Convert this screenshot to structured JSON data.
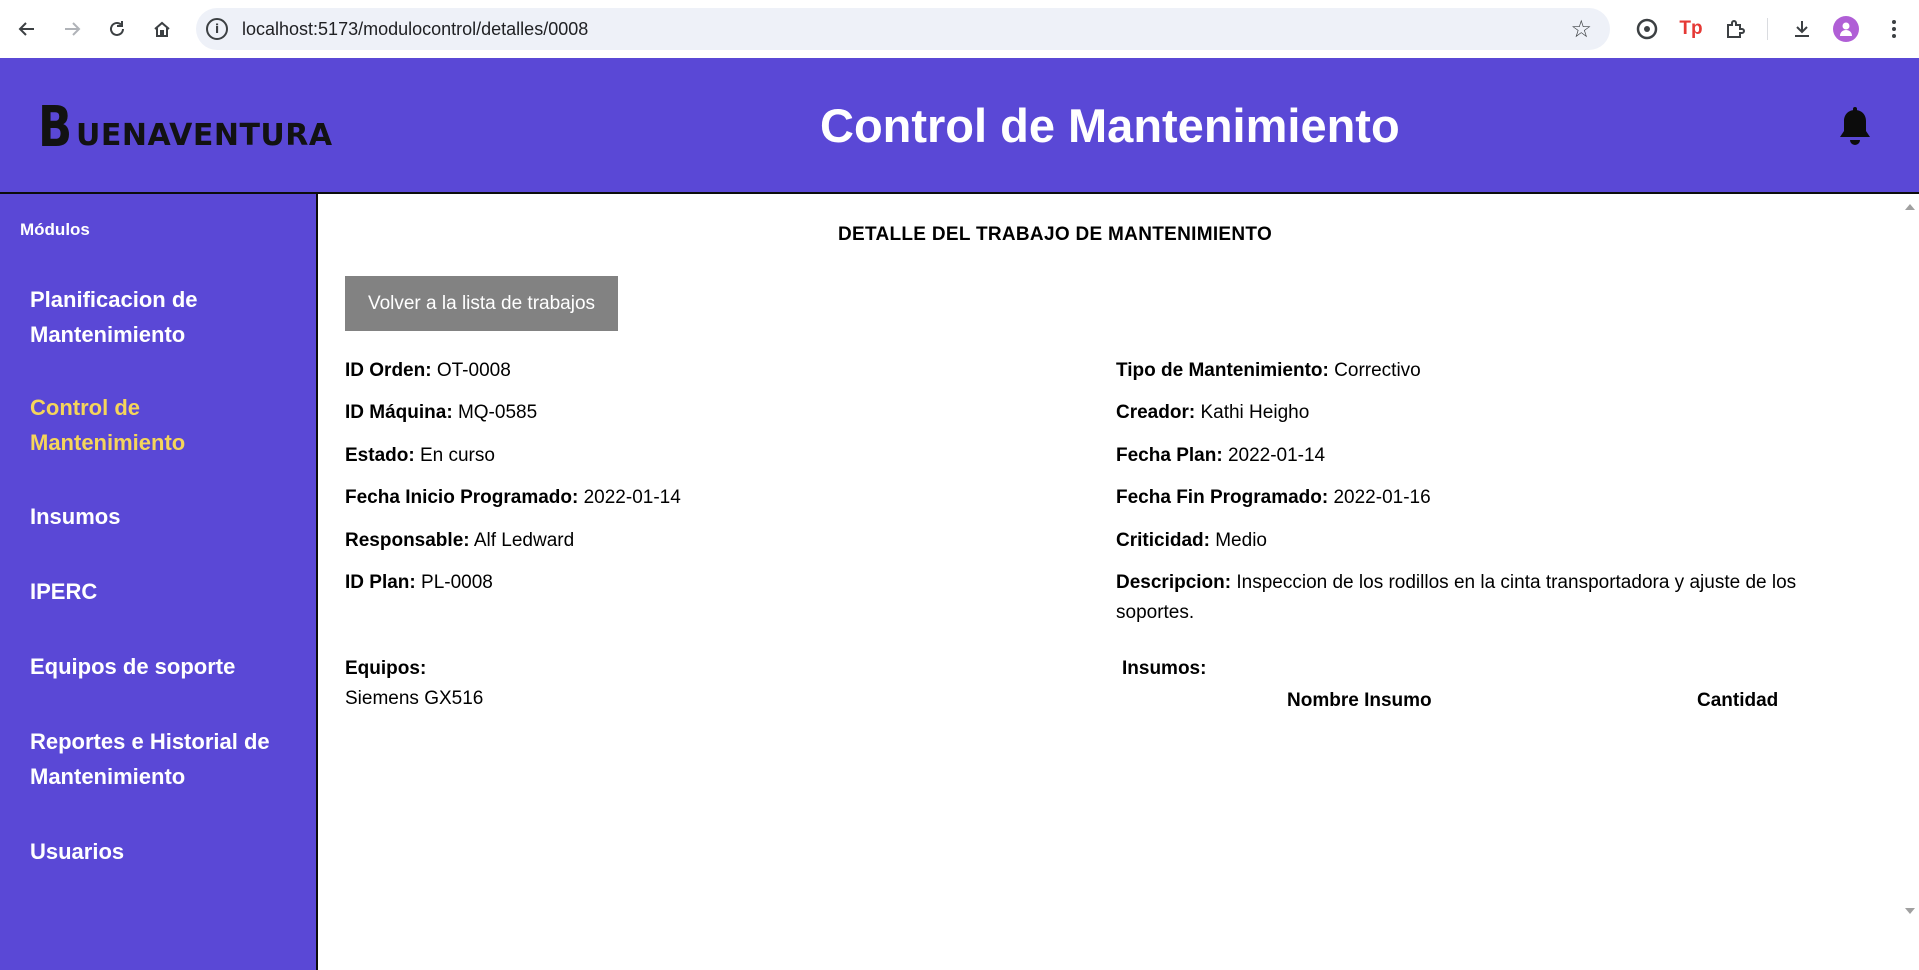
{
  "browser": {
    "url": "localhost:5173/modulocontrol/detalles/0008",
    "tp_label": "Tp"
  },
  "header": {
    "logo_b": "B",
    "logo_rest": "UENAVENTURA",
    "title": "Control de Mantenimiento"
  },
  "sidebar": {
    "heading": "Módulos",
    "items": [
      {
        "label": "Planificacion de Mantenimiento"
      },
      {
        "label": "Control de Mantenimiento"
      },
      {
        "label": "Insumos"
      },
      {
        "label": "IPERC"
      },
      {
        "label": "Equipos de soporte"
      },
      {
        "label": "Reportes e Historial de Mantenimiento"
      },
      {
        "label": "Usuarios"
      }
    ]
  },
  "detail": {
    "title": "DETALLE DEL TRABAJO DE MANTENIMIENTO",
    "back_button": "Volver a la lista de trabajos",
    "left_fields": [
      {
        "label": "ID Orden:",
        "value": "OT-0008"
      },
      {
        "label": "ID Máquina:",
        "value": "MQ-0585"
      },
      {
        "label": "Estado:",
        "value": "En curso"
      },
      {
        "label": "Fecha Inicio Programado:",
        "value": "2022-01-14"
      },
      {
        "label": "Responsable:",
        "value": "Alf Ledward"
      },
      {
        "label": "ID Plan:",
        "value": "PL-0008"
      }
    ],
    "right_fields": [
      {
        "label": "Tipo de Mantenimiento:",
        "value": "Correctivo"
      },
      {
        "label": "Creador:",
        "value": "Kathi Heigho"
      },
      {
        "label": "Fecha Plan:",
        "value": "2022-01-14"
      },
      {
        "label": "Fecha Fin Programado:",
        "value": "2022-01-16"
      },
      {
        "label": "Criticidad:",
        "value": "Medio"
      },
      {
        "label": "Descripcion:",
        "value": "Inspeccion de los rodillos en la cinta transportadora y ajuste de los soportes."
      }
    ],
    "equipos_label": "Equipos:",
    "equipos": [
      "Siemens GX516"
    ],
    "insumos_label": "Insumos:",
    "insumos_columns": [
      "Nombre Insumo",
      "Cantidad"
    ]
  }
}
